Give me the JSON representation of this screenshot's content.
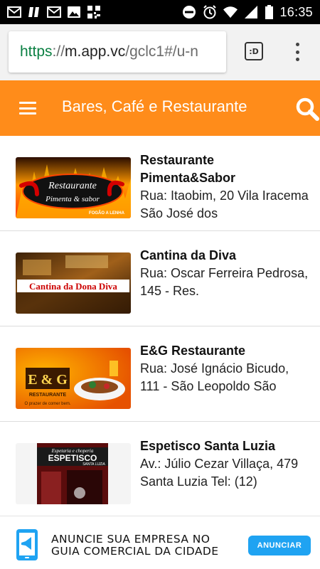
{
  "status_bar": {
    "time": "16:35",
    "icons": [
      "gmail-icon",
      "app-icon",
      "gmail-icon",
      "image-icon",
      "qr-icon",
      "do-not-disturb-icon",
      "alarm-icon",
      "wifi-icon",
      "signal-icon",
      "battery-icon"
    ]
  },
  "browser": {
    "url_scheme": "https",
    "url_sep": "://",
    "url_host": "m.app.vc",
    "url_path": "/gclc1#/u-n",
    "tabs_label": ":D"
  },
  "header": {
    "title": "Bares, Café e Restaurante",
    "color": "#ff8c1a"
  },
  "listings": [
    {
      "name": "Restaurante Pimenta&Sabor",
      "address": "Rua: Itaobim, 20 Vila Iracema São José dos",
      "thumb_text": [
        "Restaurante",
        "Pimenta & sabor",
        "FOGÃO A LENHA"
      ]
    },
    {
      "name": "Cantina da Diva",
      "address": "Rua: Oscar Ferreira Pedrosa, 145 -  Res.",
      "thumb_text": [
        "Cantina da Dona Diva"
      ]
    },
    {
      "name": "E&G Restaurante",
      "address": "Rua: José Ignácio Bicudo, 111 -  São Leopoldo São",
      "thumb_text": [
        "E & G",
        "RESTAURANTE",
        "O prazer de comer bem."
      ]
    },
    {
      "name": "Espetisco Santa Luzia",
      "address": "Av.: Júlio Cezar Villaça, 479 Santa Luzia Tel:  (12)",
      "thumb_text": [
        "Espetaria e choperia",
        "ESPETISCO",
        "SANTA LUZIA"
      ]
    }
  ],
  "ad": {
    "line1": "ANUNCIE SUA EMPRESA NO",
    "line2": "GUIA COMERCIAL DA CIDADE",
    "button": "ANUNCIAR"
  }
}
